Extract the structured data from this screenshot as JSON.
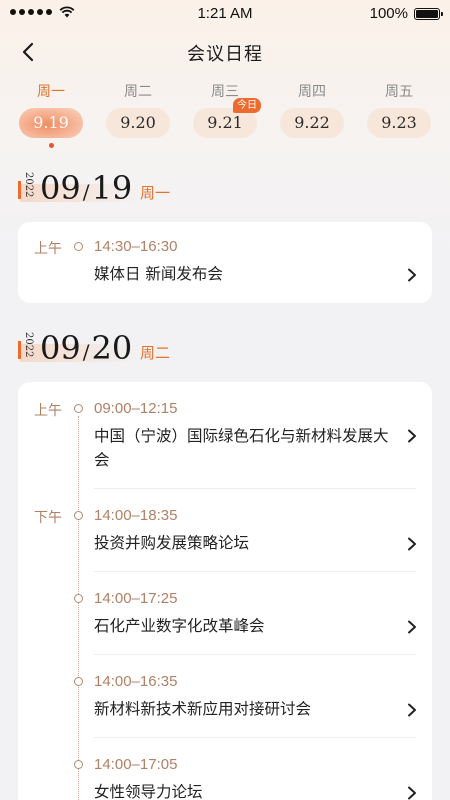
{
  "status_bar": {
    "time": "1:21 AM",
    "battery": "100%"
  },
  "nav": {
    "title": "会议日程"
  },
  "week": [
    {
      "weekday": "周一",
      "date": "9.19",
      "active": true,
      "today": false
    },
    {
      "weekday": "周二",
      "date": "9.20",
      "active": false,
      "today": false
    },
    {
      "weekday": "周三",
      "date": "9.21",
      "active": false,
      "today": true
    },
    {
      "weekday": "周四",
      "date": "9.22",
      "active": false,
      "today": false
    },
    {
      "weekday": "周五",
      "date": "9.23",
      "active": false,
      "today": false
    }
  ],
  "today_badge": "今日",
  "days": [
    {
      "year": "2022",
      "month": "09",
      "day": "19",
      "weekday": "周一",
      "sessions": [
        {
          "period": "上午",
          "time": "14:30–16:30",
          "title": "媒体日 新闻发布会"
        }
      ]
    },
    {
      "year": "2022",
      "month": "09",
      "day": "20",
      "weekday": "周二",
      "sessions": [
        {
          "period": "上午",
          "time": "09:00–12:15",
          "title": "中国（宁波）国际绿色石化与新材料发展大会"
        },
        {
          "period": "下午",
          "time": "14:00–18:35",
          "title": "投资并购发展策略论坛"
        },
        {
          "period": "",
          "time": "14:00–17:25",
          "title": "石化产业数字化改革峰会"
        },
        {
          "period": "",
          "time": "14:00–16:35",
          "title": "新材料新技术新应用对接研讨会"
        },
        {
          "period": "",
          "time": "14:00–17:05",
          "title": "女性领导力论坛"
        }
      ]
    }
  ],
  "colors": {
    "accent": "#ef6a2d",
    "muted_brown": "#b08166",
    "background": "#f2f2f4"
  }
}
